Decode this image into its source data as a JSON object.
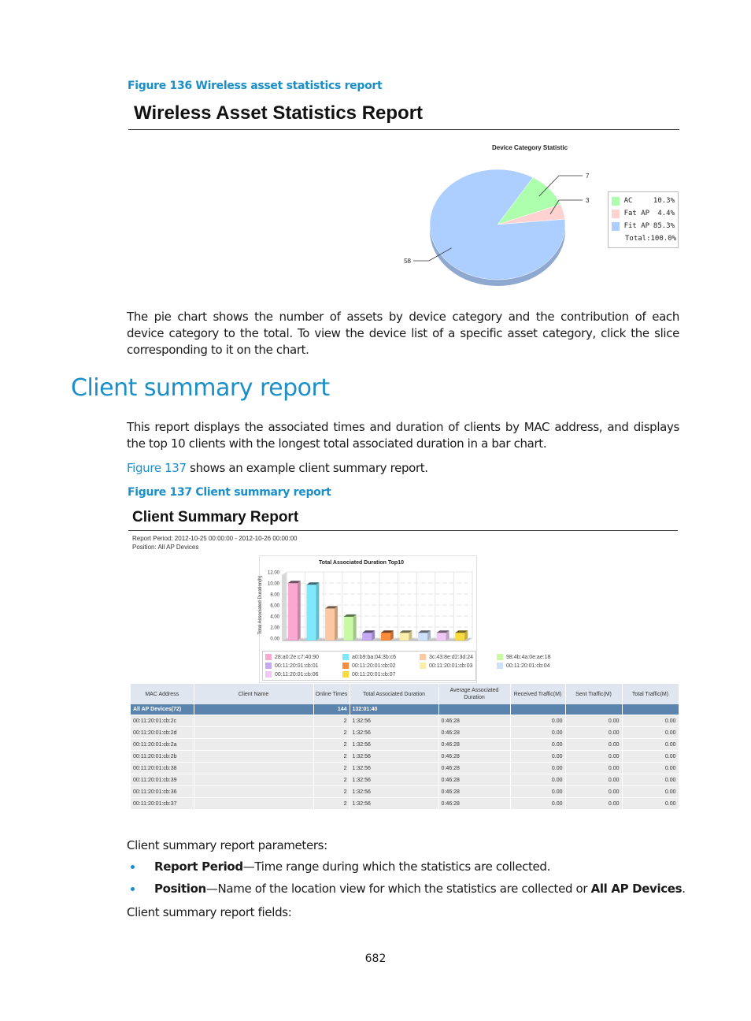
{
  "figure136": {
    "caption": "Figure 136 Wireless asset statistics report",
    "report_title": "Wireless Asset Statistics Report"
  },
  "pie": {
    "chart_data": {
      "type": "pie",
      "title": "Device Category Statistic",
      "slices": [
        {
          "label": "AC",
          "value": 7,
          "percent": "10.3%",
          "color": "#adffad"
        },
        {
          "label": "Fat AP",
          "value": 3,
          "percent": "4.4%",
          "color": "#ffd2d2"
        },
        {
          "label": "Fit AP",
          "value": 58,
          "percent": "85.3%",
          "color": "#adcfff"
        }
      ],
      "total_label": "Total:100.0%",
      "legend_position": "right"
    }
  },
  "para1": "The pie chart shows the number of assets by device category and the contribution of each device category to the total. To view the device list of a specific asset category, click the slice corresponding to it on the chart.",
  "section": {
    "heading": "Client summary report",
    "intro": "This report displays the associated times and duration of clients by MAC address, and displays the top 10 clients with the longest total associated duration in a bar chart.",
    "ref_link": "Figure 137",
    "ref_rest": " shows an example client summary report."
  },
  "figure137": {
    "caption": "Figure 137 Client summary report",
    "report_title": "Client Summary Report",
    "report_period": "Report Period: 2012-10-25 00:00:00  -  2012-10-26 00:00:00",
    "position": "Position: All AP Devices"
  },
  "bar": {
    "chart_data": {
      "type": "bar",
      "title": "Total Associated Duration Top10",
      "xlabel": "",
      "ylabel": "Total Associated Duration(h)",
      "ylim": [
        0,
        12
      ],
      "yticks": [
        "0.00",
        "2.00",
        "4.00",
        "6.00",
        "8.00",
        "10.00",
        "12.00"
      ],
      "grid": true,
      "legend_position": "bottom",
      "categories": [
        "28:a0:2e:c7:40:90",
        "a0:b9:ba:04:3b:c6",
        "3c:43:8e:d2:3d:24",
        "98:4b:4a:0e:ae:18",
        "00:11:20:01:cb:01",
        "00:11:20:01:cb:02",
        "00:11:20:01:cb:03",
        "00:11:20:01:cb:04",
        "00:11:20:01:cb:06",
        "00:11:20:01:cb:07"
      ],
      "values": [
        10.4,
        10.1,
        5.8,
        4.3,
        1.4,
        1.4,
        1.4,
        1.4,
        1.4,
        1.4
      ],
      "colors": [
        "#f9a8cf",
        "#7fe8fb",
        "#fdc8a2",
        "#c8f9a3",
        "#c5a8f7",
        "#fb8c3c",
        "#fbeea8",
        "#cfe0fb",
        "#efc8f5",
        "#fbdb3c"
      ]
    }
  },
  "table": {
    "headers": [
      "MAC Address",
      "Client Name",
      "Online Times",
      "Total Associated Duration",
      "Average Associated Duration",
      "Received Traffic(M)",
      "Sent Traffic(M)",
      "Total Traffic(M)"
    ],
    "total_row": [
      "All AP Devices(72)",
      "",
      "144",
      "132:01:40",
      "",
      "",
      "",
      ""
    ],
    "rows": [
      [
        "00:11:20:01:cb:2c",
        "",
        "2",
        "1:32:56",
        "0:46:28",
        "0.00",
        "0.00",
        "0.00"
      ],
      [
        "00:11:20:01:cb:2d",
        "",
        "2",
        "1:32:56",
        "0:46:28",
        "0.00",
        "0.00",
        "0.00"
      ],
      [
        "00:11:20:01:cb:2a",
        "",
        "2",
        "1:32:56",
        "0:46:28",
        "0.00",
        "0.00",
        "0.00"
      ],
      [
        "00:11:20:01:cb:2b",
        "",
        "2",
        "1:32:56",
        "0:46:28",
        "0.00",
        "0.00",
        "0.00"
      ],
      [
        "00:11:20:01:cb:38",
        "",
        "2",
        "1:32:56",
        "0:46:28",
        "0.00",
        "0.00",
        "0.00"
      ],
      [
        "00:11:20:01:cb:39",
        "",
        "2",
        "1:32:56",
        "0:46:28",
        "0.00",
        "0.00",
        "0.00"
      ],
      [
        "00:11:20:01:cb:36",
        "",
        "2",
        "1:32:56",
        "0:46:28",
        "0.00",
        "0.00",
        "0.00"
      ],
      [
        "00:11:20:01:cb:37",
        "",
        "2",
        "1:32:56",
        "0:46:28",
        "0.00",
        "0.00",
        "0.00"
      ]
    ]
  },
  "params": {
    "intro": "Client summary report parameters:",
    "items": [
      {
        "term": "Report Period",
        "desc": "—Time range during which the statistics are collected.",
        "tail_bold": "",
        "tail": ""
      },
      {
        "term": "Position",
        "desc": "—Name of the location view for which the statistics are collected or ",
        "tail_bold": "All AP Devices",
        "tail": "."
      }
    ],
    "fields_intro": "Client summary report fields:"
  },
  "page_number": "682"
}
